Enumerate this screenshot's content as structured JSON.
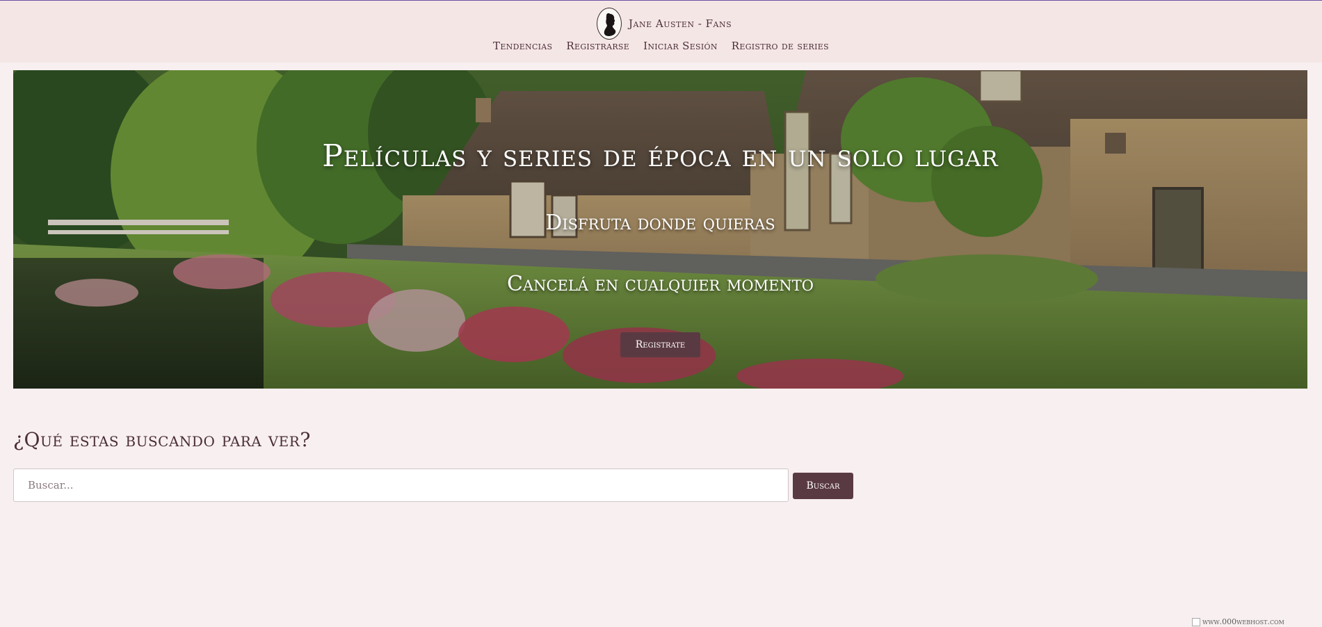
{
  "header": {
    "brand": "Jane Austen - Fans",
    "nav": [
      "Tendencias",
      "Registrarse",
      "Iniciar Sesión",
      "Registro de series"
    ]
  },
  "hero": {
    "title": "Películas y series de época en un solo lugar",
    "subtitle_1": "Disfruta donde quieras",
    "subtitle_2": "Cancelá en cualquier momento",
    "button": "Registrate"
  },
  "search": {
    "title": "¿Qué estas buscando para ver?",
    "placeholder": "Buscar...",
    "value": "",
    "button": "Buscar"
  },
  "footer": {
    "host_badge": "www.000webhost.com"
  },
  "colors": {
    "header_bg": "#f5e6e6",
    "page_bg": "#f8eff0",
    "accent": "#5a3a42",
    "text": "#4a2e38"
  },
  "icons": {
    "logo": "silhouette-portrait-icon",
    "host_badge": "broken-image-icon"
  }
}
